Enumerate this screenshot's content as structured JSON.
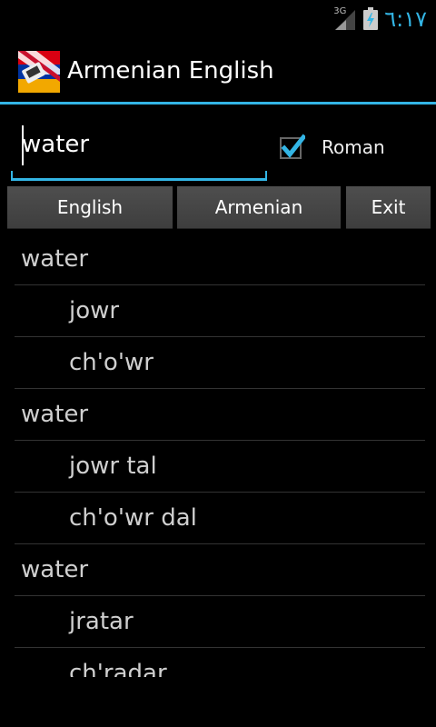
{
  "status_bar": {
    "network_label": "3G",
    "clock": "٦:١٧",
    "icons": [
      "signal-icon",
      "battery-charging-icon"
    ],
    "accent_color": "#33b5e5"
  },
  "app": {
    "title": "Armenian English",
    "icon": "flag-dictionary-icon"
  },
  "search": {
    "value": "water",
    "placeholder": ""
  },
  "roman_checkbox": {
    "label": "Roman",
    "checked": true
  },
  "buttons": {
    "english": "English",
    "armenian": "Armenian",
    "exit": "Exit"
  },
  "results": [
    {
      "text": "water",
      "kind": "term"
    },
    {
      "text": "jowr",
      "kind": "translation"
    },
    {
      "text": "ch'o'wr",
      "kind": "translation"
    },
    {
      "text": "water",
      "kind": "term"
    },
    {
      "text": "jowr tal",
      "kind": "translation"
    },
    {
      "text": "ch'o'wr dal",
      "kind": "translation"
    },
    {
      "text": "water",
      "kind": "term"
    },
    {
      "text": "jratar",
      "kind": "translation"
    },
    {
      "text": "ch'radar",
      "kind": "translation"
    }
  ]
}
